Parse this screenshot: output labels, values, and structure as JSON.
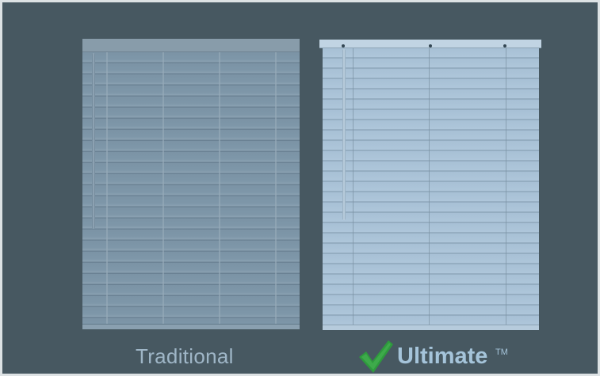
{
  "comparison": {
    "traditional": {
      "label": "Traditional"
    },
    "ultimate": {
      "label": "Ultimate",
      "trademark": "TM",
      "icon": "checkmark-icon",
      "icon_color": "#2e9a3d"
    }
  },
  "colors": {
    "background": "#475861",
    "traditional_blind": "#7e97a9",
    "ultimate_blind": "#aec6da",
    "traditional_label": "#9fb6c7",
    "ultimate_label": "#a5c4da"
  }
}
